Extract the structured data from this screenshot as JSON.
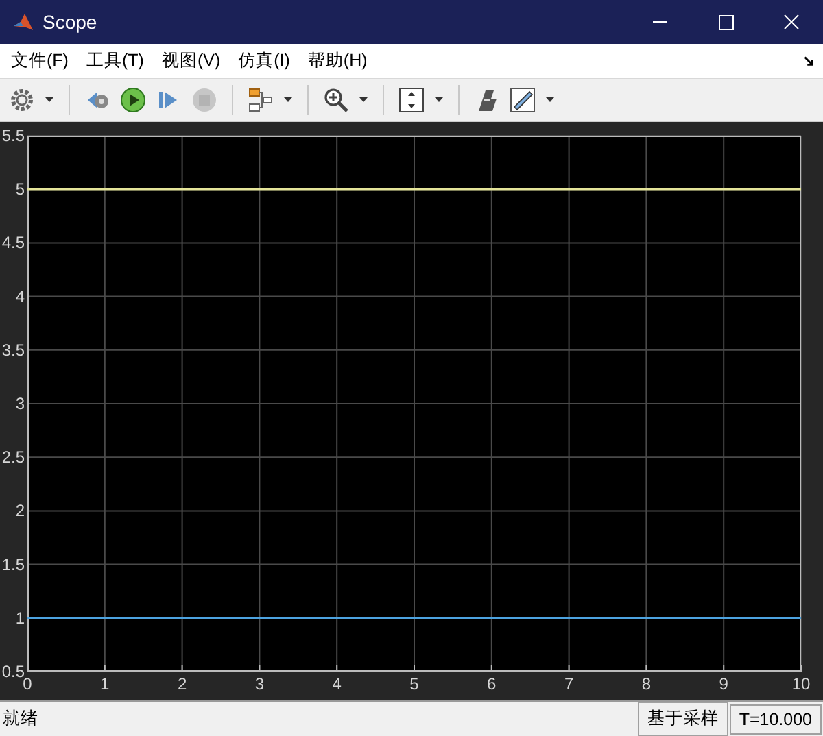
{
  "window": {
    "title": "Scope"
  },
  "menu": [
    {
      "label": "文件(F)"
    },
    {
      "label": "工具(T)"
    },
    {
      "label": "视图(V)"
    },
    {
      "label": "仿真(I)"
    },
    {
      "label": "帮助(H)"
    }
  ],
  "toolbar": [
    {
      "kind": "settings",
      "dropdown": true,
      "disabled": false
    },
    {
      "kind": "sep"
    },
    {
      "kind": "step-back",
      "dropdown": false,
      "disabled": false
    },
    {
      "kind": "run",
      "dropdown": false,
      "disabled": false
    },
    {
      "kind": "step-forward",
      "dropdown": false,
      "disabled": false
    },
    {
      "kind": "stop",
      "dropdown": false,
      "disabled": true
    },
    {
      "kind": "sep"
    },
    {
      "kind": "highlight",
      "dropdown": true,
      "disabled": false
    },
    {
      "kind": "sep"
    },
    {
      "kind": "zoom",
      "dropdown": true,
      "disabled": false
    },
    {
      "kind": "sep"
    },
    {
      "kind": "fit",
      "dropdown": true,
      "disabled": false
    },
    {
      "kind": "sep"
    },
    {
      "kind": "style",
      "dropdown": false,
      "disabled": false
    },
    {
      "kind": "measure",
      "dropdown": true,
      "disabled": false
    }
  ],
  "plot": {
    "chart_data": {
      "type": "line",
      "grid": true,
      "xlim": [
        0,
        10
      ],
      "ylim": [
        0.5,
        5.5
      ],
      "xticks": [
        0,
        1,
        2,
        3,
        4,
        5,
        6,
        7,
        8,
        9,
        10
      ],
      "yticks": [
        0.5,
        1,
        1.5,
        2,
        2.5,
        3,
        3.5,
        4,
        4.5,
        5,
        5.5
      ],
      "x": [
        0,
        10
      ],
      "series": [
        {
          "color": "#e5e59a",
          "values": [
            5,
            5
          ]
        },
        {
          "color": "#4da3e0",
          "values": [
            1,
            1
          ]
        }
      ]
    }
  },
  "status_bar": {
    "message": "就绪",
    "mode": "基于采样",
    "time": "T=10.000"
  }
}
